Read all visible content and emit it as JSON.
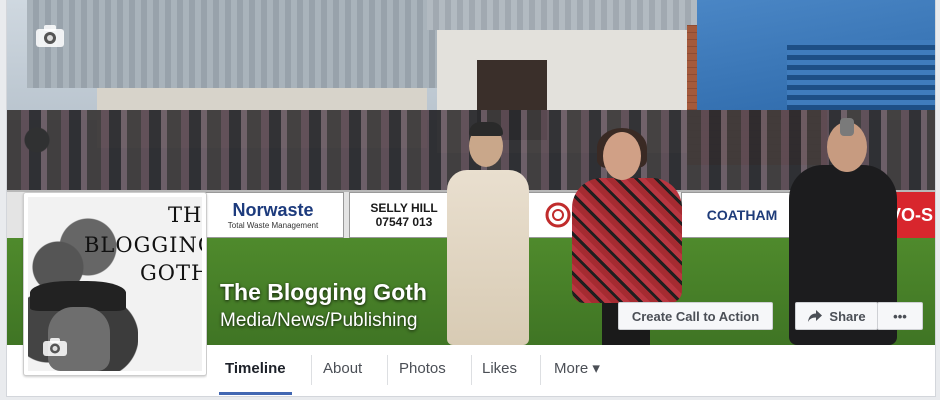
{
  "page": {
    "name": "The Blogging Goth",
    "category": "Media/News/Publishing"
  },
  "profile_picture": {
    "text_lines": [
      "THE",
      "BLOGGING",
      "GOTH"
    ]
  },
  "cover_ads": {
    "norwaste": "Norwaste",
    "norwaste_sub": "Total Waste Management",
    "selly": "SELLY HILL",
    "selly_phone": "07547 013",
    "coatham": "COATHAM",
    "vo": "VO-S"
  },
  "actions": {
    "cta_label": "Create Call to Action",
    "share_label": "Share",
    "more_label": "•••"
  },
  "tabs": [
    {
      "label": "Timeline",
      "active": true
    },
    {
      "label": "About"
    },
    {
      "label": "Photos"
    },
    {
      "label": "Likes"
    },
    {
      "label": "More ▾"
    }
  ],
  "icons": {
    "cover_camera": "camera-icon",
    "profile_camera": "camera-icon",
    "share": "share-arrow-icon"
  },
  "colors": {
    "accent": "#4267b2",
    "button_bg": "#f6f7f9",
    "ad_red": "#d8262d"
  }
}
